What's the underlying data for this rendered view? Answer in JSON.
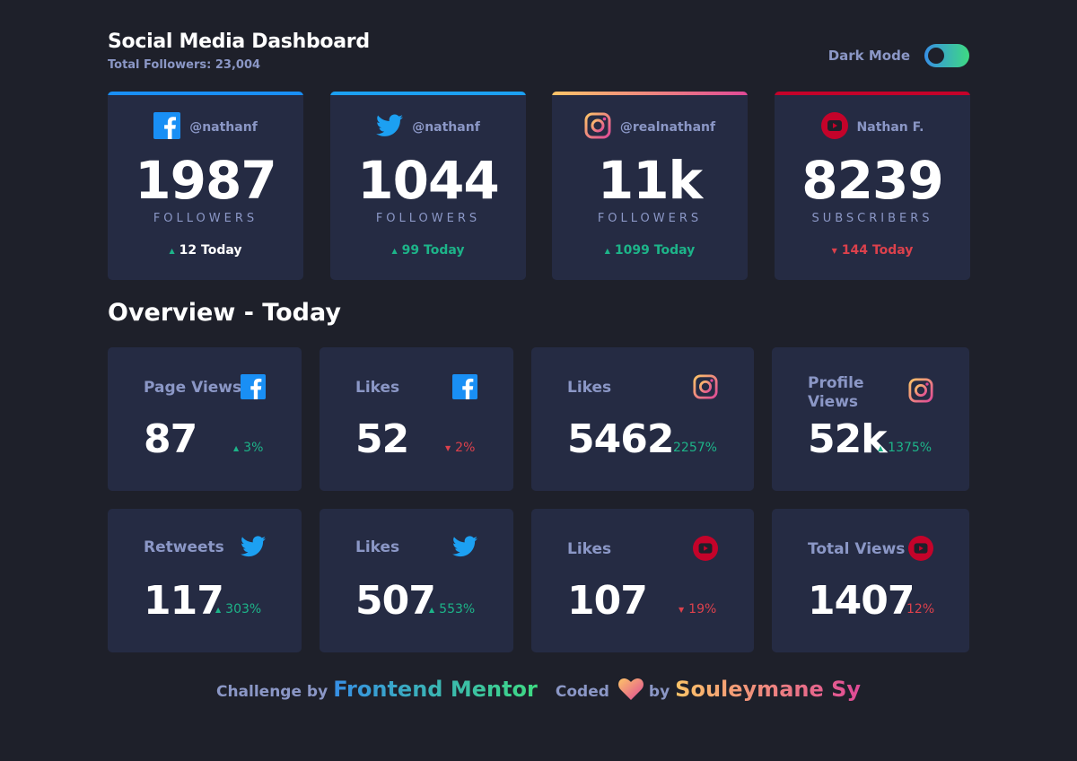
{
  "header": {
    "title": "Social Media Dashboard",
    "total_followers": "Total Followers: 23,004",
    "dark_mode_label": "Dark Mode",
    "dark_mode_on": true
  },
  "colors": {
    "background": "#1e202a",
    "card": "#252b43",
    "muted": "#8b97c6",
    "up": "#1db489",
    "down": "#dc414c",
    "facebook": "#198ff5",
    "twitter": "#1ca0f2",
    "youtube": "#c4032a"
  },
  "cards": [
    {
      "network": "facebook",
      "icon": "facebook-icon",
      "handle": "@nathanf",
      "value": "1987",
      "unit": "FOLLOWERS",
      "today": "12 Today",
      "trend": "up"
    },
    {
      "network": "twitter",
      "icon": "twitter-icon",
      "handle": "@nathanf",
      "value": "1044",
      "unit": "FOLLOWERS",
      "today": "99 Today",
      "trend": "up"
    },
    {
      "network": "instagram",
      "icon": "instagram-icon",
      "handle": "@realnathanf",
      "value": "11k",
      "unit": "FOLLOWERS",
      "today": "1099 Today",
      "trend": "up"
    },
    {
      "network": "youtube",
      "icon": "youtube-icon",
      "handle": "Nathan F.",
      "value": "8239",
      "unit": "SUBSCRIBERS",
      "today": "144 Today",
      "trend": "down"
    }
  ],
  "overview": {
    "title": "Overview - Today",
    "items": [
      {
        "label": "Page Views",
        "icon": "facebook-icon",
        "value": "87",
        "change": "3%",
        "trend": "up"
      },
      {
        "label": "Likes",
        "icon": "facebook-icon",
        "value": "52",
        "change": "2%",
        "trend": "down"
      },
      {
        "label": "Likes",
        "icon": "instagram-icon",
        "value": "5462",
        "change": "2257%",
        "trend": "up"
      },
      {
        "label": "Profile Views",
        "icon": "instagram-icon",
        "value": "52k",
        "change": "1375%",
        "trend": "up"
      },
      {
        "label": "Retweets",
        "icon": "twitter-icon",
        "value": "117",
        "change": "303%",
        "trend": "up"
      },
      {
        "label": "Likes",
        "icon": "twitter-icon",
        "value": "507",
        "change": "553%",
        "trend": "up"
      },
      {
        "label": "Likes",
        "icon": "youtube-icon",
        "value": "107",
        "change": "19%",
        "trend": "down"
      },
      {
        "label": "Total Views",
        "icon": "youtube-icon",
        "value": "1407",
        "change": "12%",
        "trend": "down"
      }
    ]
  },
  "footer": {
    "challenge_by": "Challenge by",
    "challenge_link": "Frontend Mentor",
    "coded": "Coded",
    "by": "by",
    "author": "Souleymane Sy"
  }
}
